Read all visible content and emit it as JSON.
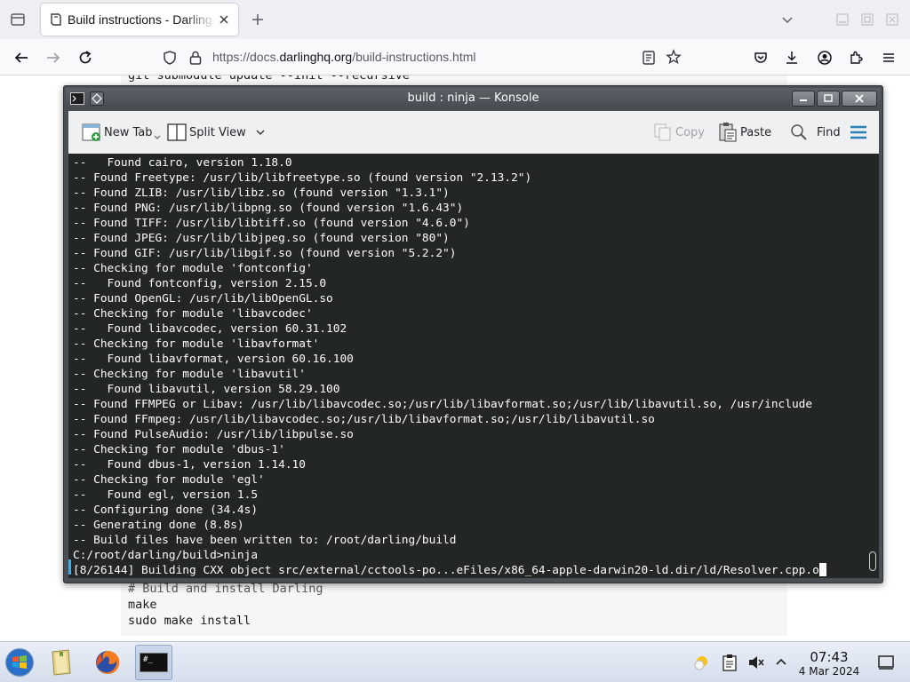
{
  "browser": {
    "tab": {
      "title": "Build instructions - Darling"
    },
    "url": {
      "prefix": "https://docs.",
      "host": "darlinghq.org",
      "path": "/build-instructions.html"
    }
  },
  "page": {
    "top_line": "git submodule update --init --recursive",
    "bottom_lines": [
      {
        "text": "# Build and install Darling",
        "kind": "comment"
      },
      {
        "text": "make",
        "kind": "code"
      },
      {
        "text": "sudo make install",
        "kind": "code"
      }
    ]
  },
  "konsole": {
    "title": "build : ninja — Konsole",
    "toolbar": {
      "new_tab": "New Tab",
      "split_view": "Split View",
      "copy": "Copy",
      "paste": "Paste",
      "find": "Find"
    },
    "lines": [
      "--   Found cairo, version 1.18.0",
      "-- Found Freetype: /usr/lib/libfreetype.so (found version \"2.13.2\")",
      "-- Found ZLIB: /usr/lib/libz.so (found version \"1.3.1\")",
      "-- Found PNG: /usr/lib/libpng.so (found version \"1.6.43\")",
      "-- Found TIFF: /usr/lib/libtiff.so (found version \"4.6.0\")",
      "-- Found JPEG: /usr/lib/libjpeg.so (found version \"80\")",
      "-- Found GIF: /usr/lib/libgif.so (found version \"5.2.2\")",
      "-- Checking for module 'fontconfig'",
      "--   Found fontconfig, version 2.15.0",
      "-- Found OpenGL: /usr/lib/libOpenGL.so",
      "-- Checking for module 'libavcodec'",
      "--   Found libavcodec, version 60.31.102",
      "-- Checking for module 'libavformat'",
      "--   Found libavformat, version 60.16.100",
      "-- Checking for module 'libavutil'",
      "--   Found libavutil, version 58.29.100",
      "-- Found FFMPEG or Libav: /usr/lib/libavcodec.so;/usr/lib/libavformat.so;/usr/lib/libavutil.so, /usr/include",
      "-- Found FFmpeg: /usr/lib/libavcodec.so;/usr/lib/libavformat.so;/usr/lib/libavutil.so",
      "-- Found PulseAudio: /usr/lib/libpulse.so",
      "-- Checking for module 'dbus-1'",
      "--   Found dbus-1, version 1.14.10",
      "-- Checking for module 'egl'",
      "--   Found egl, version 1.5",
      "-- Configuring done (34.4s)",
      "-- Generating done (8.8s)",
      "-- Build files have been written to: /root/darling/build",
      "C:/root/darling/build>ninja",
      "[8/26144] Building CXX object src/external/cctools-po...eFiles/x86_64-apple-darwin20-ld.dir/ld/Resolver.cpp.o"
    ]
  },
  "taskbar": {
    "time": "07:43",
    "date": "4 Mar 2024",
    "terminal_icon_text": "#_"
  },
  "colors": {
    "terminal_bg": "#232627",
    "terminal_fg": "#fcfcfc",
    "accent": "#3daee9",
    "titlebar": "#4a4f56"
  }
}
